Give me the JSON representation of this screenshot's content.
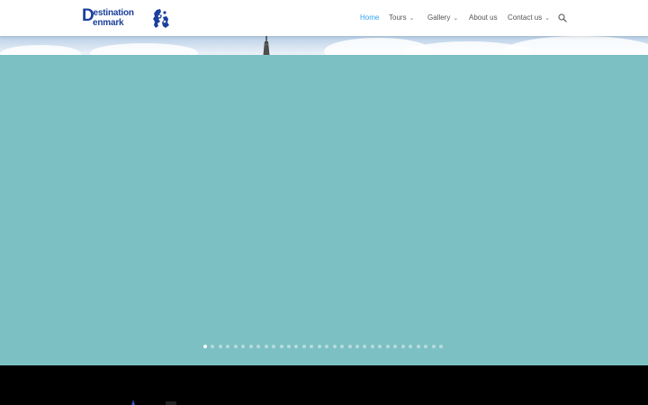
{
  "brand": {
    "line1_initial": "D",
    "line1_rest": "estination",
    "line2": "enmark",
    "color": "#1b3f9c"
  },
  "nav": {
    "items": [
      {
        "label": "Home",
        "active": true,
        "dropdown": false
      },
      {
        "label": "Tours",
        "active": false,
        "dropdown": true
      },
      {
        "label": "Gallery",
        "active": false,
        "dropdown": true
      },
      {
        "label": "About us",
        "active": false,
        "dropdown": false
      },
      {
        "label": "Contact us",
        "active": false,
        "dropdown": true
      }
    ],
    "active_color": "#2ea3f2",
    "text_color": "#555555",
    "search_icon": "search-icon"
  },
  "hero": {
    "background_color": "#7cc0c3",
    "slide_count": 32,
    "active_slide": 1
  },
  "footer": {
    "background_color": "#000000"
  }
}
